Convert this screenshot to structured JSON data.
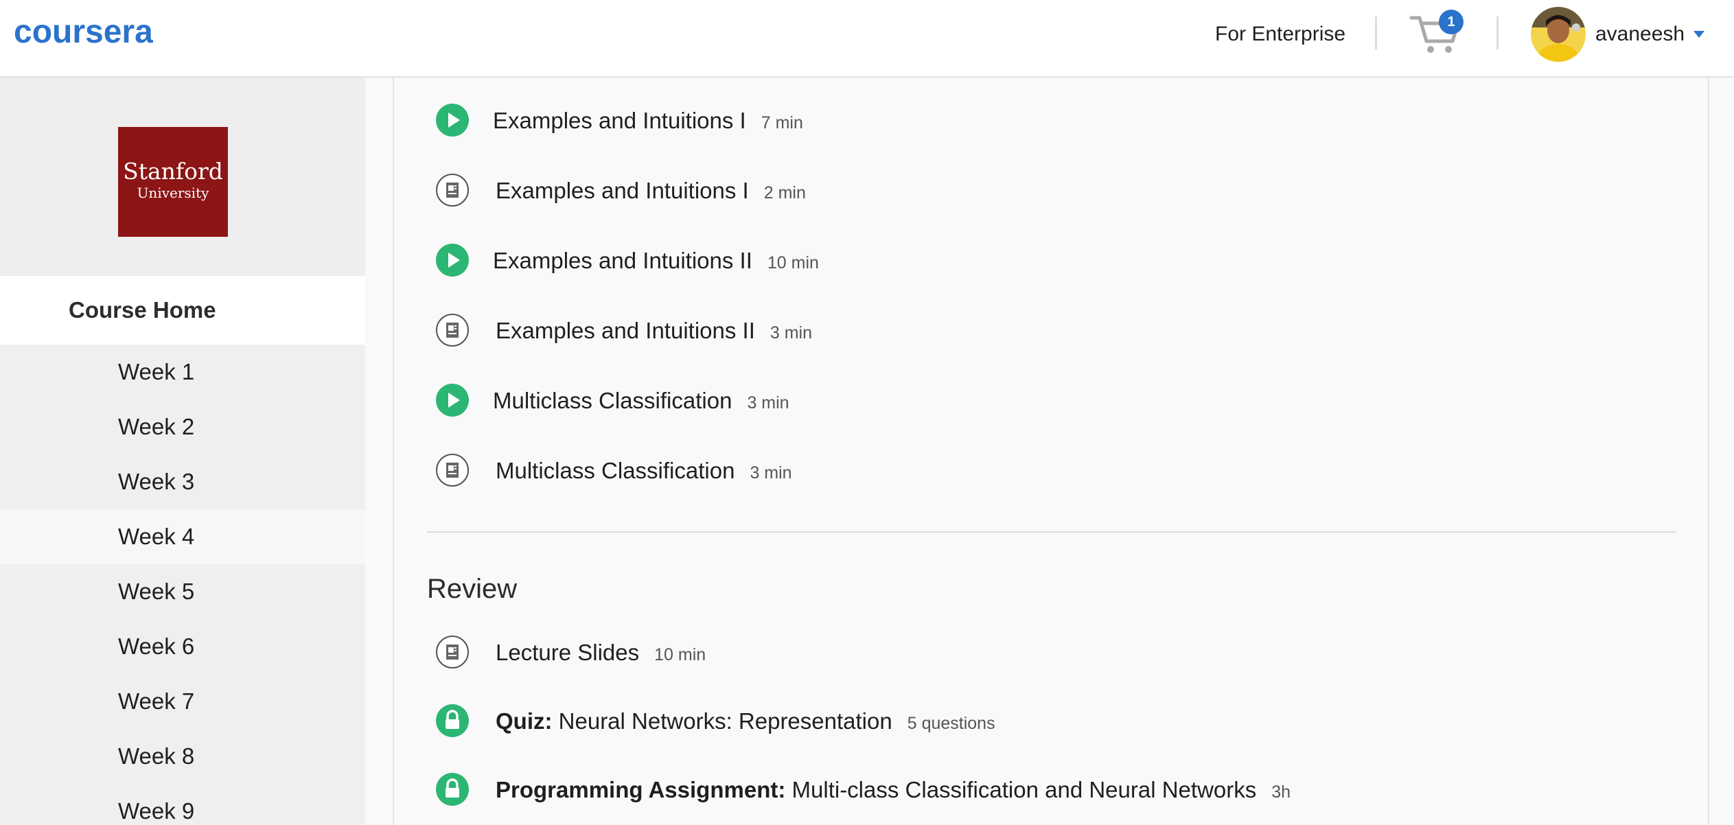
{
  "header": {
    "logo_text": "coursera",
    "enterprise_label": "For Enterprise",
    "cart_count": "1",
    "username": "avaneesh",
    "brand_color": "#2a73cc"
  },
  "sidebar": {
    "university": {
      "line1": "Stanford",
      "line2": "University",
      "color": "#8c1515"
    },
    "course_home": "Course Home",
    "weeks": [
      "Week 1",
      "Week 2",
      "Week 3",
      "Week 4",
      "Week 5",
      "Week 6",
      "Week 7",
      "Week 8",
      "Week 9"
    ],
    "active_week": "Week 4"
  },
  "main": {
    "lessons": [
      {
        "type": "video",
        "icon": "play-icon",
        "title": "Examples and Intuitions I",
        "duration": "7 min"
      },
      {
        "type": "reading",
        "icon": "reading-icon",
        "title": "Examples and Intuitions I",
        "duration": "2 min"
      },
      {
        "type": "video",
        "icon": "play-icon",
        "title": "Examples and Intuitions II",
        "duration": "10 min"
      },
      {
        "type": "reading",
        "icon": "reading-icon",
        "title": "Examples and Intuitions II",
        "duration": "3 min"
      },
      {
        "type": "video",
        "icon": "play-icon",
        "title": "Multiclass Classification",
        "duration": "3 min"
      },
      {
        "type": "reading",
        "icon": "reading-icon",
        "title": "Multiclass Classification",
        "duration": "3 min"
      }
    ],
    "review": {
      "heading": "Review",
      "items": [
        {
          "type": "reading",
          "icon": "reading-icon",
          "prefix": "",
          "title": "Lecture Slides",
          "duration": "10 min"
        },
        {
          "type": "quiz",
          "icon": "lock-icon",
          "prefix": "Quiz:",
          "title": "Neural Networks: Representation",
          "duration": "5 questions"
        },
        {
          "type": "assignment",
          "icon": "lock-icon",
          "prefix": "Programming Assignment:",
          "title": "Multi-class Classification and Neural Networks",
          "duration": "3h"
        }
      ]
    },
    "accent_green": "#2bb673"
  }
}
